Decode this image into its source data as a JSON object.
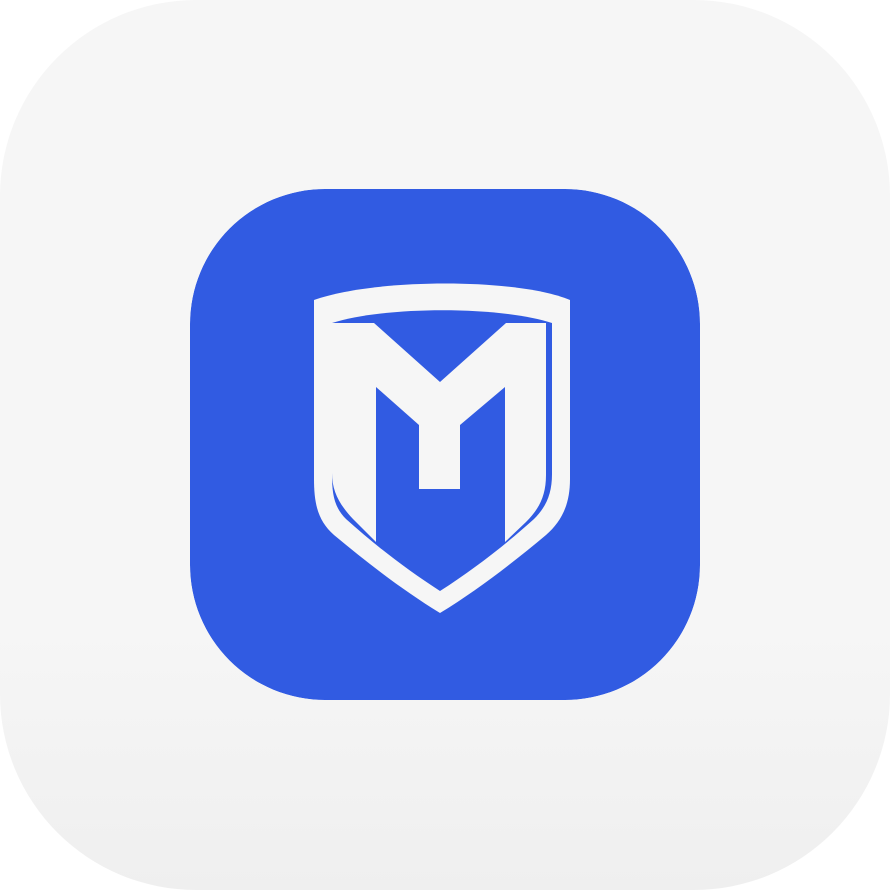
{
  "icon": {
    "name": "shield-m-logo-icon",
    "tile_color": "#f6f6f6",
    "badge_color": "#315be2",
    "glyph_color": "#f6f6f6"
  }
}
